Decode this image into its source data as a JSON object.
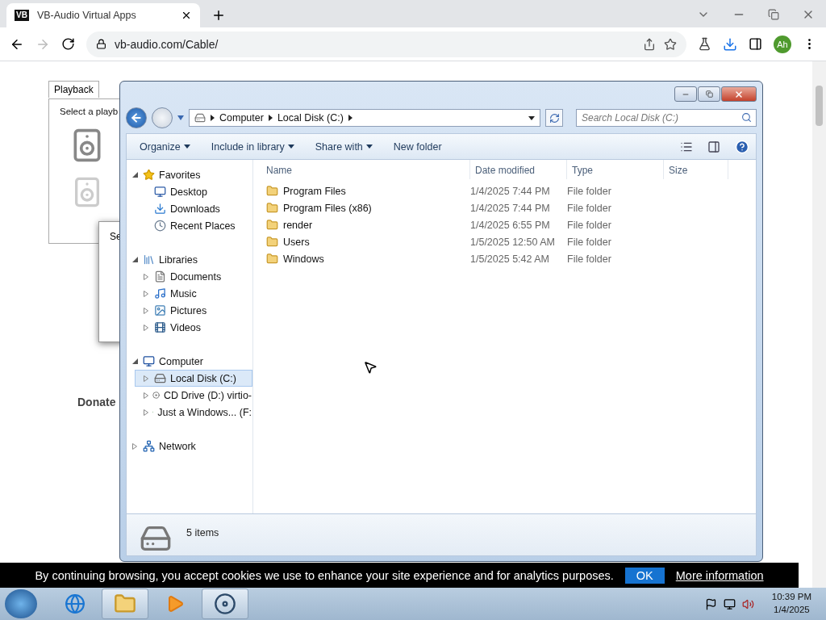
{
  "browser": {
    "tab_logo": "VB",
    "tab_title": "VB-Audio Virtual Apps",
    "address": "vb-audio.com/Cable/",
    "profile": "Ah"
  },
  "page": {
    "dialog_tab": "Playback",
    "dialog_text": "Select a playb",
    "sub_dialog_text": "Se",
    "donate": "Donate"
  },
  "explorer": {
    "breadcrumb": [
      "Computer",
      "Local Disk (C:)"
    ],
    "search_placeholder": "Search Local Disk (C:)",
    "toolbar": [
      {
        "label": "Organize",
        "dropdown": true
      },
      {
        "label": "Include in library",
        "dropdown": true
      },
      {
        "label": "Share with",
        "dropdown": true
      },
      {
        "label": "New folder",
        "dropdown": false
      }
    ],
    "nav": [
      {
        "label": "Favorites",
        "expanded": true,
        "selected": false,
        "children": [
          {
            "label": "Desktop",
            "selected": false
          },
          {
            "label": "Downloads",
            "selected": false
          },
          {
            "label": "Recent Places",
            "selected": false
          }
        ]
      },
      {
        "label": "Libraries",
        "expanded": true,
        "selected": false,
        "children": [
          {
            "label": "Documents",
            "expanded": false,
            "selected": false
          },
          {
            "label": "Music",
            "expanded": false,
            "selected": false
          },
          {
            "label": "Pictures",
            "expanded": false,
            "selected": false
          },
          {
            "label": "Videos",
            "expanded": false,
            "selected": false
          }
        ]
      },
      {
        "label": "Computer",
        "expanded": true,
        "selected": false,
        "children": [
          {
            "label": "Local Disk (C:)",
            "expanded": false,
            "selected": true
          },
          {
            "label": "CD Drive (D:) virtio-",
            "expanded": false,
            "selected": false
          },
          {
            "label": "Just a Windows... (F:",
            "expanded": false,
            "selected": false
          }
        ]
      },
      {
        "label": "Network",
        "expanded": false,
        "selected": false
      }
    ],
    "columns": [
      "Name",
      "Date modified",
      "Type",
      "Size"
    ],
    "rows": [
      {
        "name": "Program Files",
        "date": "1/4/2025 7:44 PM",
        "type": "File folder"
      },
      {
        "name": "Program Files (x86)",
        "date": "1/4/2025 7:44 PM",
        "type": "File folder"
      },
      {
        "name": "render",
        "date": "1/4/2025 6:55 PM",
        "type": "File folder"
      },
      {
        "name": "Users",
        "date": "1/5/2025 12:50 AM",
        "type": "File folder"
      },
      {
        "name": "Windows",
        "date": "1/5/2025 5:42 AM",
        "type": "File folder"
      }
    ],
    "item_count": "5 items"
  },
  "cookie": {
    "text": "By continuing browsing, you accept cookies we use to enhance your site experience and for analytics purposes.",
    "ok": "OK",
    "more": "More information"
  },
  "taskbar": {
    "apps": [
      {
        "kind": "ie",
        "active": false
      },
      {
        "kind": "explorer",
        "active": true
      },
      {
        "kind": "media",
        "active": false
      },
      {
        "kind": "chrome",
        "active": true
      }
    ],
    "time": "10:39 PM",
    "date": "1/4/2025"
  }
}
